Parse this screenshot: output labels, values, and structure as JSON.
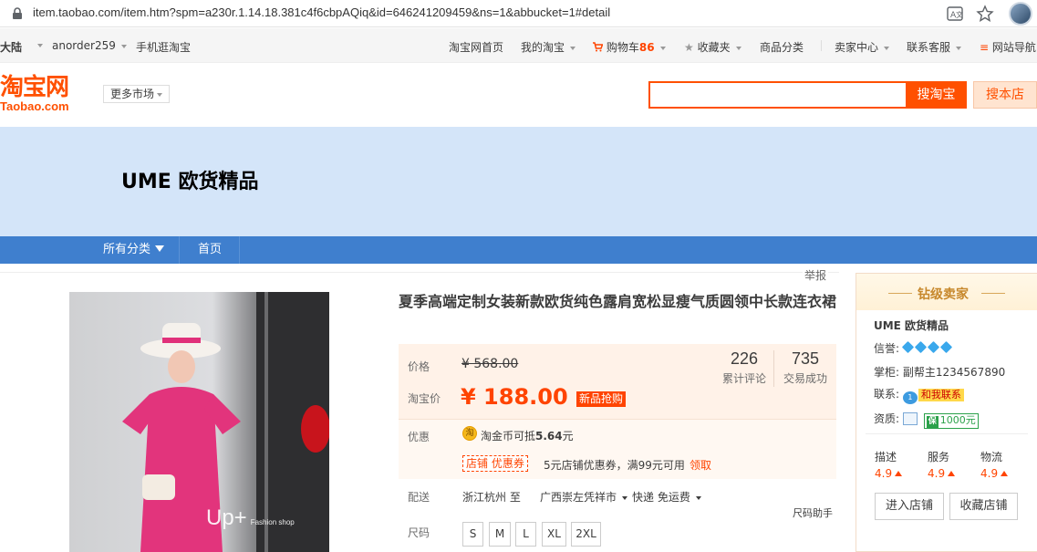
{
  "browser": {
    "url": "item.taobao.com/item.htm?spm=a230r.1.14.18.381c4f6cbpAQiq&id=646241209459&ns=1&abbucket=1#detail"
  },
  "topnav": {
    "region": "大陆",
    "user": "anorder259",
    "mobile": "手机逛淘宝",
    "home": "淘宝网首页",
    "my_taobao": "我的淘宝",
    "cart_label": "购物车",
    "cart_count": "86",
    "favorites": "收藏夹",
    "categories": "商品分类",
    "seller_center": "卖家中心",
    "support": "联系客服",
    "sitemap": "网站导航"
  },
  "header": {
    "logo_cn": "淘宝网",
    "logo_en": "Taobao.com",
    "more_market": "更多市场",
    "search_button": "搜淘宝",
    "shop_search_button": "搜本店",
    "search_value": ""
  },
  "shop": {
    "name": "UME 欧货精品",
    "nav_all": "所有分类",
    "nav_home": "首页",
    "report": "举报"
  },
  "product": {
    "title": "夏季高端定制女装新款欧货纯色露肩宽松显瘦气质圆领中长款连衣裙",
    "image_watermark": "Up+",
    "image_watermark_small": "Fashion shop",
    "price_label": "价格",
    "old_price": "¥ 568.00",
    "taobao_price_label": "淘宝价",
    "new_price": "¥ 188.00",
    "new_badge": "新品抢购",
    "reviews_count": "226",
    "reviews_label": "累计评论",
    "sales_count": "735",
    "sales_label": "交易成功",
    "promo_label": "优惠",
    "coin_text": "淘金币可抵",
    "coin_amount": "5.64",
    "coin_unit": "元",
    "coupon_badge": "店铺 优惠券",
    "coupon_text": "5元店铺优惠券，满99元可用",
    "coupon_claim": "领取",
    "delivery_label": "配送",
    "delivery_from": "浙江杭州 至",
    "delivery_to": "广西崇左凭祥市",
    "shipping": "快递 免运费",
    "size_label": "尺码",
    "sizes": [
      "S",
      "M",
      "L",
      "XL",
      "2XL"
    ],
    "size_help": "尺码助手"
  },
  "seller": {
    "level": "钻级卖家",
    "name": "UME 欧货精品",
    "credit_label": "信誉:",
    "owner_label": "掌柜:",
    "owner_name": "副帮主1234567890",
    "contact_label": "联系:",
    "contact_badge": "和我联系",
    "contact_count": "1",
    "qual_label": "资质:",
    "deposit": "1000元",
    "scores": [
      {
        "label": "描述",
        "value": "4.9"
      },
      {
        "label": "服务",
        "value": "4.9"
      },
      {
        "label": "物流",
        "value": "4.9"
      }
    ],
    "enter_shop": "进入店铺",
    "fav_shop": "收藏店铺"
  }
}
